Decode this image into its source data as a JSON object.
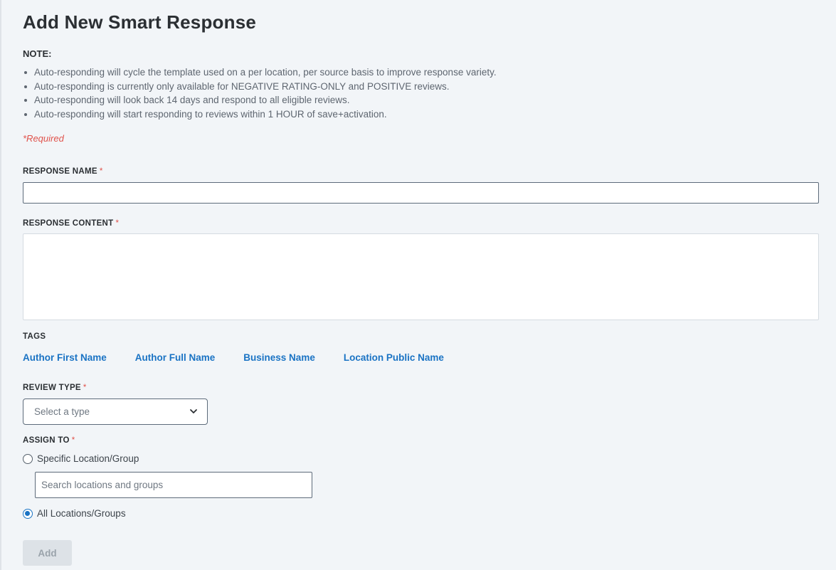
{
  "page": {
    "title": "Add New Smart Response"
  },
  "note": {
    "label": "NOTE:",
    "items": [
      "Auto-responding will cycle the template used on a per location, per source basis to improve response variety.",
      "Auto-responding is currently only available for NEGATIVE RATING-ONLY and POSITIVE reviews.",
      "Auto-responding will look back 14 days and respond to all eligible reviews.",
      "Auto-responding will start responding to reviews within 1 HOUR of save+activation."
    ]
  },
  "required_note": "*Required",
  "required_marker": "*",
  "response_name": {
    "label": "RESPONSE NAME",
    "value": ""
  },
  "response_content": {
    "label": "RESPONSE CONTENT",
    "value": ""
  },
  "tags": {
    "label": "TAGS",
    "items": [
      "Author First Name",
      "Author Full Name",
      "Business Name",
      "Location Public Name"
    ]
  },
  "review_type": {
    "label": "REVIEW TYPE",
    "placeholder": "Select a type",
    "icon": "chevron-down-icon"
  },
  "assign_to": {
    "label": "ASSIGN TO",
    "specific_option": "Specific Location/Group",
    "search_placeholder": "Search locations and groups",
    "all_option": "All Locations/Groups",
    "selected": "All Locations/Groups"
  },
  "add_button": {
    "label": "Add",
    "enabled": false
  },
  "colors": {
    "background": "#f2f5f8",
    "link": "#1a73c4",
    "required": "#e0524b",
    "disabled_button": "#dde2e7"
  }
}
